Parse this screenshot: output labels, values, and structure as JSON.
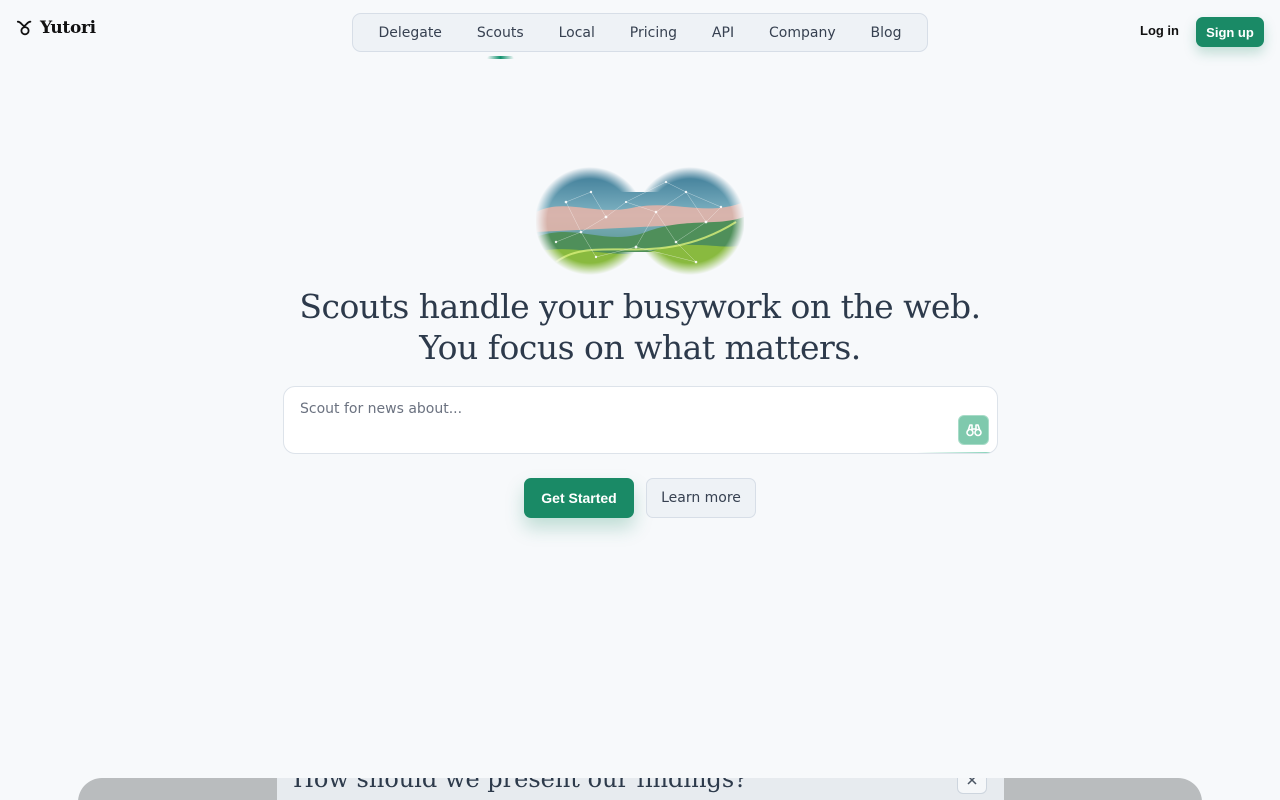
{
  "brand": {
    "name": "Yutori",
    "logo_icon": "yutori-logo-icon"
  },
  "nav": {
    "items": [
      {
        "label": "Delegate"
      },
      {
        "label": "Scouts",
        "active": true
      },
      {
        "label": "Local"
      },
      {
        "label": "Pricing"
      },
      {
        "label": "API"
      },
      {
        "label": "Company"
      },
      {
        "label": "Blog"
      }
    ]
  },
  "auth": {
    "login_label": "Log in",
    "signup_label": "Sign up"
  },
  "hero": {
    "art_icon": "binoculars-landscape-art",
    "headline_line1": "Scouts handle your busywork on the web.",
    "headline_line2": "You focus on what matters."
  },
  "search": {
    "placeholder": "Scout for news about...",
    "value": "",
    "submit_icon": "binoculars-icon"
  },
  "cta": {
    "primary_label": "Get Started",
    "secondary_label": "Learn more"
  },
  "preview": {
    "question": "How should we present our findings?",
    "close_icon": "close-icon"
  },
  "colors": {
    "accent": "#1a8a66",
    "accent_light": "#7fc9ad",
    "background": "#f7f9fb",
    "nav_background": "#eef2f6",
    "text_primary": "#2d3a4b"
  }
}
